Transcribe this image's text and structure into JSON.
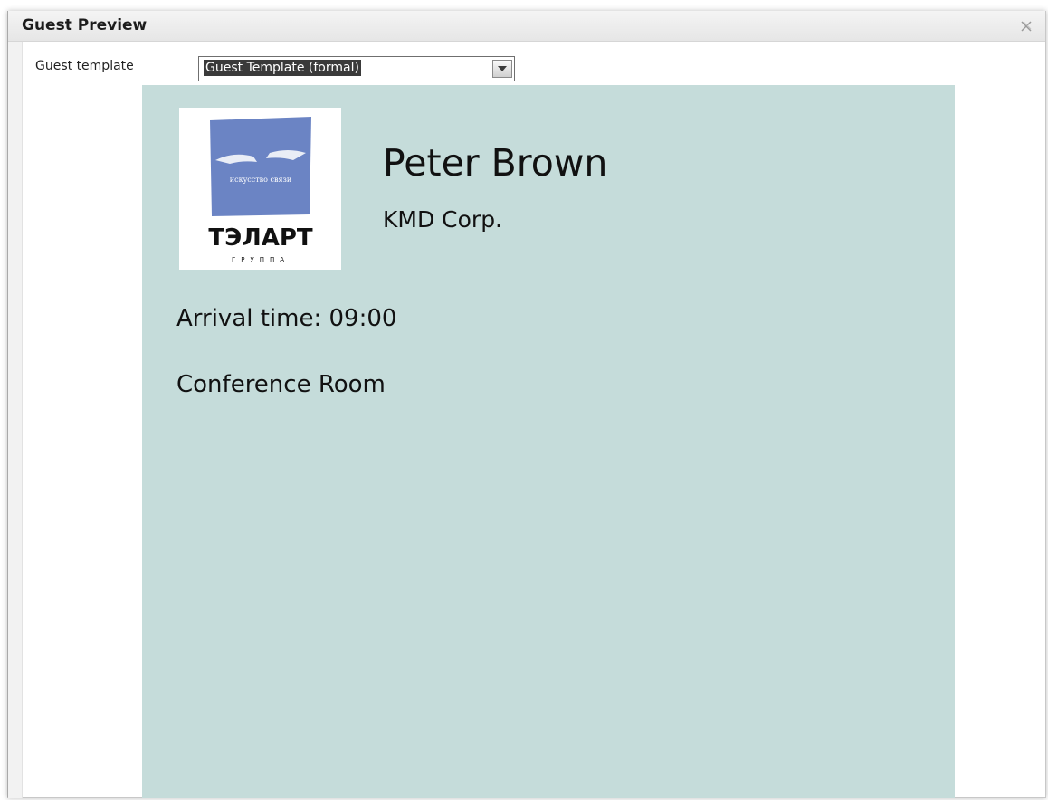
{
  "window": {
    "title": "Guest Preview",
    "close_icon": "close-icon"
  },
  "form": {
    "template_label": "Guest template",
    "template_selected": "Guest Template (formal)"
  },
  "preview": {
    "background_color": "#c5dcda",
    "guest_name": "Peter Brown",
    "company": "KMD Corp.",
    "arrival": "Arrival time: 09:00",
    "location": "Conference Room",
    "logo": {
      "icon": "company-logo-icon",
      "tagline": "искусство связи",
      "brand": "ТЭЛАРТ",
      "subbrand": "ГРУППА",
      "brand_color": "#6b84c4"
    }
  }
}
